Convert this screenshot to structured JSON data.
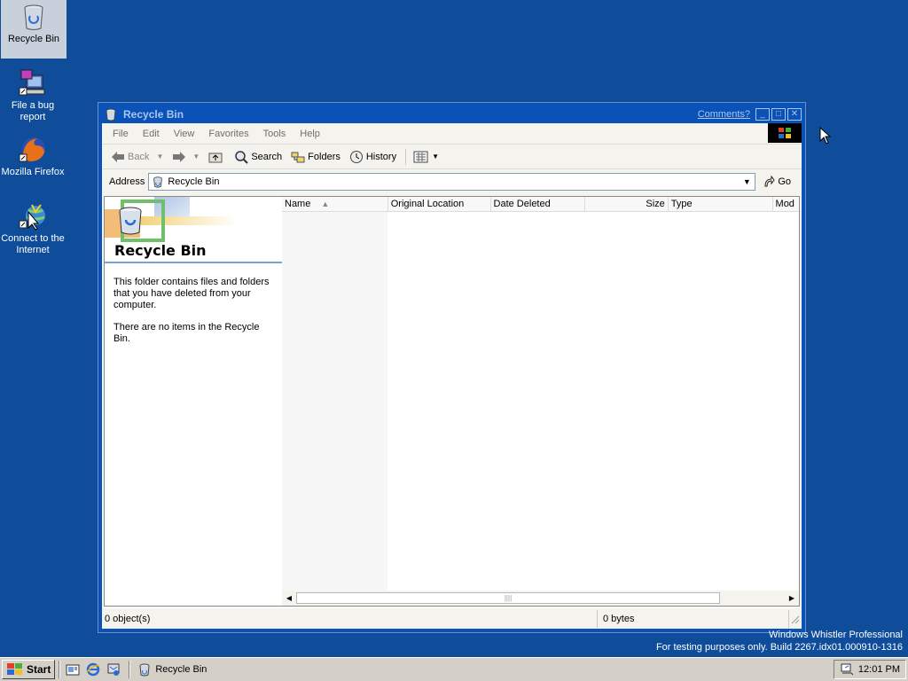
{
  "desktop": {
    "icons": [
      {
        "label": "Recycle Bin",
        "icon": "recycle-bin-icon"
      },
      {
        "label": "File a bug report",
        "icon": "bug-report-icon"
      },
      {
        "label": "Mozilla Firefox",
        "icon": "firefox-icon"
      },
      {
        "label": "Connect to the Internet",
        "icon": "connect-internet-icon"
      }
    ],
    "watermark_line1": "Windows Whistler Professional",
    "watermark_line2": "For testing purposes only. Build 2267.idx01.000910-1316"
  },
  "window": {
    "title": "Recycle Bin",
    "comments_link": "Comments?",
    "menu": [
      "File",
      "Edit",
      "View",
      "Favorites",
      "Tools",
      "Help"
    ],
    "toolbar": {
      "back": "Back",
      "search": "Search",
      "folders": "Folders",
      "history": "History"
    },
    "address": {
      "label": "Address",
      "value": "Recycle Bin",
      "go": "Go"
    },
    "left_pane": {
      "title": "Recycle Bin",
      "description": "This folder contains files and folders that you have deleted from your computer.",
      "empty_message": "There are no items in the Recycle Bin."
    },
    "columns": [
      "Name",
      "Original Location",
      "Date Deleted",
      "Size",
      "Type",
      "Mod"
    ],
    "status": {
      "objects": "0 object(s)",
      "size": "0 bytes"
    }
  },
  "taskbar": {
    "start": "Start",
    "task": "Recycle Bin",
    "clock": "12:01 PM"
  },
  "colors": {
    "desktop": "#0f4c9a",
    "titlebar": "#0a52b8",
    "client": "#f4f3ee"
  }
}
